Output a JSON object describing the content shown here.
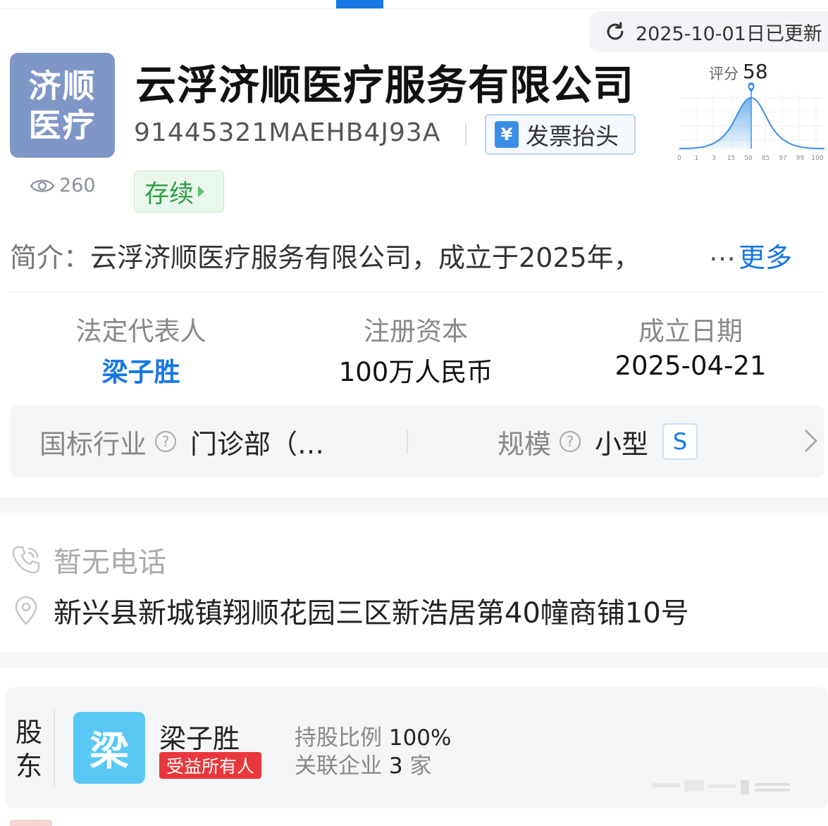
{
  "update": {
    "text": "2025-10-01日已更新"
  },
  "company": {
    "logo_line1": "济顺",
    "logo_line2": "医疗",
    "name": "云浮济顺医疗服务有限公司",
    "credit_code": "91445321MAEHB4J93A",
    "views": "260",
    "status": "存续",
    "invoice_label": "发票抬头",
    "invoice_icon_glyph": "¥"
  },
  "score": {
    "label": "评分",
    "value": "58",
    "ticks": [
      "0",
      "1",
      "3",
      "15",
      "50",
      "85",
      "97",
      "99",
      "100"
    ]
  },
  "intro": {
    "label": "简介：",
    "text": "云浮济顺医疗服务有限公司，成立于2025年，",
    "ellipsis": "…",
    "more": "更多"
  },
  "info": [
    {
      "key": "法定代表人",
      "value": "梁子胜"
    },
    {
      "key": "注册资本",
      "value": "100万人民币"
    },
    {
      "key": "成立日期",
      "value": "2025-04-21"
    }
  ],
  "industry": {
    "label": "国标行业",
    "value": "门诊部（…",
    "scale_label": "规模",
    "scale_value": "小型",
    "scale_badge": "S"
  },
  "contact": {
    "phone": "暂无电话",
    "address": "新兴县新城镇翔顺花园三区新浩居第40幢商铺10号"
  },
  "shareholder": {
    "section_label": "股东",
    "avatar_char": "梁",
    "name": "梁子胜",
    "badge": "受益所有人",
    "share_label": "持股比例",
    "share_value": "100%",
    "related_label": "关联企业",
    "related_value": "3",
    "related_unit": "家"
  },
  "colors": {
    "accent": "#1677e5",
    "status_green": "#2e9e47",
    "logo_bg": "#7f97c6",
    "avatar_bg": "#5ac8f5",
    "badge_red": "#e8383d"
  }
}
